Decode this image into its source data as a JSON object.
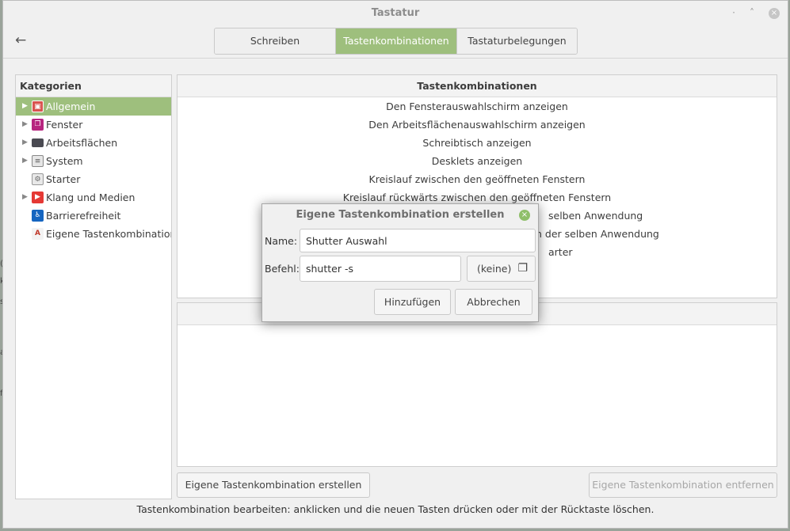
{
  "window": {
    "title": "Tastatur"
  },
  "window_controls": {
    "minimize": "·",
    "maximize": "˄",
    "close": "×"
  },
  "header": {
    "back_icon": "←",
    "tabs": [
      {
        "label": "Schreiben",
        "active": false
      },
      {
        "label": "Tastenkombinationen",
        "active": true
      },
      {
        "label": "Tastaturbelegungen",
        "active": false
      }
    ]
  },
  "sidebar": {
    "title": "Kategorien",
    "items": [
      {
        "label": "Allgemein",
        "icon": "general-icon",
        "has_children": true,
        "selected": true
      },
      {
        "label": "Fenster",
        "icon": "window-icon",
        "has_children": true,
        "selected": false
      },
      {
        "label": "Arbeitsflächen",
        "icon": "workspace-icon",
        "has_children": true,
        "selected": false
      },
      {
        "label": "System",
        "icon": "system-icon",
        "has_children": true,
        "selected": false
      },
      {
        "label": "Starter",
        "icon": "launcher-icon",
        "has_children": false,
        "selected": false
      },
      {
        "label": "Klang und Medien",
        "icon": "media-icon",
        "has_children": true,
        "selected": false
      },
      {
        "label": "Barrierefreiheit",
        "icon": "accessibility-icon",
        "has_children": false,
        "selected": false
      },
      {
        "label": "Eigene Tastenkombinationen",
        "icon": "custom-shortcut-icon",
        "has_children": false,
        "selected": false
      }
    ]
  },
  "shortcuts": {
    "title": "Tastenkombinationen",
    "rows": [
      "Den Fensterauswahlschirm anzeigen",
      "Den Arbeitsflächenauswahlschirm anzeigen",
      "Schreibtisch anzeigen",
      "Desklets anzeigen",
      "Kreislauf zwischen den geöffneten Fenstern",
      "Kreislauf rückwärts zwischen den geöffneten Fenstern",
      "selben Anwendung",
      "n der selben Anwendung",
      "arter"
    ]
  },
  "buttons": {
    "create": "Eigene Tastenkombination erstellen",
    "remove": "Eigene Tastenkombination entfernen"
  },
  "footer": {
    "hint": "Tastenkombination bearbeiten: anklicken und die neuen Tasten drücken oder mit der Rücktaste löschen."
  },
  "dialog": {
    "title": "Eigene Tastenkombination erstellen",
    "close_icon": "×",
    "name_label": "Name:",
    "name_value": "Shutter Auswahl",
    "command_label": "Befehl:",
    "command_value": "shutter -s",
    "file_button_label": "(keine)",
    "add_label": "Hinzufügen",
    "cancel_label": "Abbrechen"
  },
  "colors": {
    "accent": "#9ebf7d",
    "window_bg": "#f0f0f0",
    "dialog_close": "#8fbf6a"
  }
}
